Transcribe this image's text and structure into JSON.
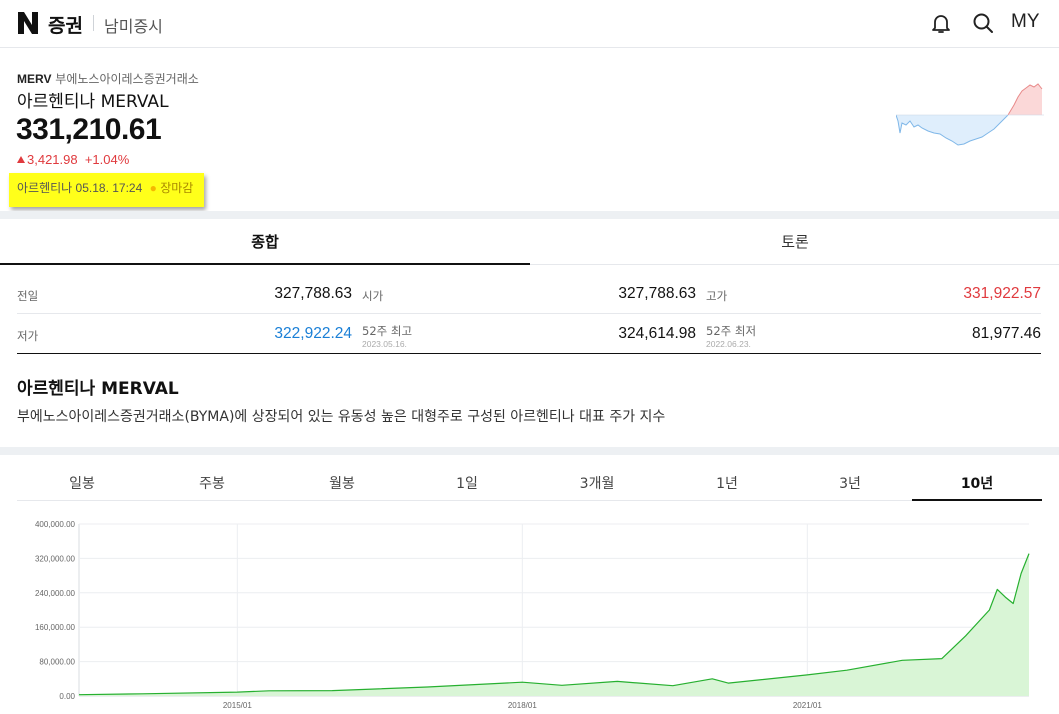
{
  "header": {
    "brand_letter": "N",
    "brand": "증권",
    "section": "남미증시",
    "my_label": "MY"
  },
  "summary": {
    "code": "MERV",
    "exchange": "부에노스아이레스증권거래소",
    "name": "아르헨티나 MERVAL",
    "price": "331,210.61",
    "change": "3,421.98",
    "change_pct": "+1.04%",
    "market": "아르헨티나",
    "datetime": "05.18. 17:24",
    "status": "장마감"
  },
  "tabs": {
    "overview": "종합",
    "discussion": "토론"
  },
  "stats": [
    {
      "label": "전일",
      "value": "327,788.63",
      "trend": ""
    },
    {
      "label": "시가",
      "value": "327,788.63",
      "trend": ""
    },
    {
      "label": "고가",
      "value": "331,922.57",
      "trend": "up"
    },
    {
      "label": "저가",
      "value": "322,922.24",
      "trend": "down"
    },
    {
      "label": "52주 최고",
      "sub": "2023.05.16.",
      "value": "324,614.98",
      "trend": ""
    },
    {
      "label": "52주 최저",
      "sub": "2022.06.23.",
      "value": "81,977.46",
      "trend": ""
    }
  ],
  "description": {
    "title": "아르헨티나 MERVAL",
    "text": "부에노스아이레스증권거래소(BYMA)에 상장되어 있는 유동성 높은 대형주로 구성된 아르헨티나 대표 주가 지수"
  },
  "period_tabs": [
    "일봉",
    "주봉",
    "월봉",
    "1일",
    "3개월",
    "1년",
    "3년",
    "10년"
  ],
  "active_period": "10년",
  "colors": {
    "up": "#e03a3e",
    "down": "#1a7fd6",
    "line": "#27b030",
    "area": "#d9f5d6",
    "highlight": "#ffff1a"
  },
  "chart_data": {
    "type": "area",
    "title": "",
    "xlabel": "",
    "ylabel": "",
    "ylim": [
      0,
      400000
    ],
    "yticks": [
      "400,000.00",
      "320,000.00",
      "240,000.00",
      "160,000.00",
      "80,000.00",
      "0.00"
    ],
    "xticks": [
      "2015/01",
      "2018/01",
      "2021/01"
    ],
    "x": [
      "2013-05",
      "2014-01",
      "2015-01",
      "2015-05",
      "2016-01",
      "2017-01",
      "2018-01",
      "2018-06",
      "2019-01",
      "2019-08",
      "2020-01",
      "2020-03",
      "2021-01",
      "2021-06",
      "2022-01",
      "2022-06",
      "2022-09",
      "2022-12",
      "2023-01",
      "2023-02",
      "2023-03",
      "2023-04",
      "2023-05"
    ],
    "series": [
      {
        "values": [
          3000,
          5000,
          9000,
          12000,
          12500,
          21000,
          32000,
          25000,
          34000,
          24000,
          40000,
          30000,
          49000,
          60000,
          83000,
          87000,
          140000,
          200000,
          248000,
          230000,
          215000,
          285000,
          331210
        ]
      }
    ]
  }
}
